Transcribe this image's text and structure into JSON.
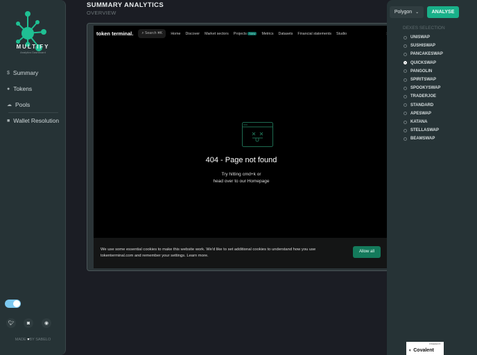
{
  "brand": {
    "name": "MULTIFY",
    "tagline": "Analytics Dashboard"
  },
  "sidebar": {
    "items": [
      {
        "label": "Summary",
        "icon": "dollar-icon"
      },
      {
        "label": "Tokens",
        "icon": "coins-icon"
      },
      {
        "label": "Pools",
        "icon": "cloud-icon"
      },
      {
        "label": "Wallet Resolution",
        "icon": "wallet-icon"
      }
    ],
    "footer": {
      "made_pre": "MADE",
      "made_post": "BY SABELO"
    }
  },
  "header": {
    "title": "SUMMARY ANALYTICS",
    "subtitle": "OVERVIEW"
  },
  "embed": {
    "logo": "token terminal.",
    "search": "Search  ⌘K",
    "nav": [
      "Home",
      "Discover",
      "Market sectors",
      "Projects",
      "Metrics",
      "Datasets",
      "Financial statements",
      "Studio"
    ],
    "new_badge": "New",
    "edge_text": "S",
    "error_title": "404 - Page not found",
    "error_line1": "Try hitting cmd+k or",
    "error_line2": "head over to our Homepage",
    "cookie_line1": "We use some essential cookies to make this website work. We'd like to set additional cookies to understand how you use",
    "cookie_line2": "tokenterminal.com and remember your settings. Learn more.",
    "allow_all": "Allow all"
  },
  "right": {
    "network": "Polygon",
    "analyse": "ANALYSE",
    "dexes_heading": "DEXES SELECTION",
    "dexes": [
      "UNISWAP",
      "SUSHISWAP",
      "PANCAKESWAP",
      "QUICKSWAP",
      "PANGOLIN",
      "SPIRITSWAP",
      "SPOOKYSWAP",
      "TRADERJOE",
      "STANDARD",
      "APESWAP",
      "KATANA",
      "STELLASWAP",
      "BEAMSWAP"
    ],
    "selected": "QUICKSWAP",
    "powered_by": "POWERED BY",
    "partner": "Covalent"
  },
  "colors": {
    "accent": "#19b089",
    "sidebar": "#263336",
    "toggle": "#7cc8ef"
  }
}
